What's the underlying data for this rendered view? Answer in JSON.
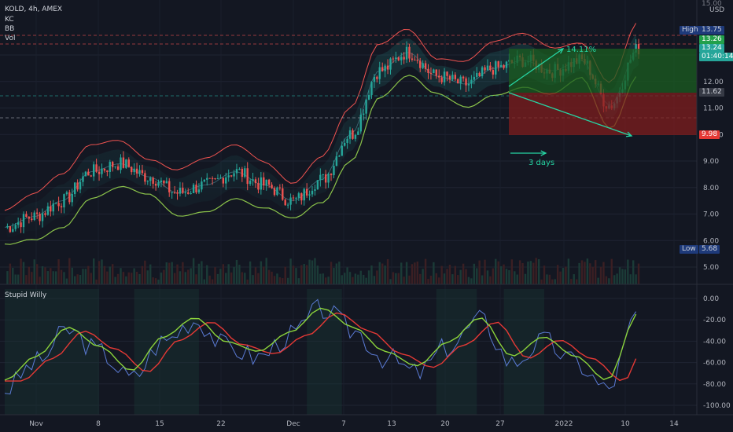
{
  "symbol": {
    "title": "KOLD, 4h, AMEX",
    "indicators": [
      "KC",
      "BB",
      "Vol"
    ]
  },
  "oscillator": {
    "title": "Stupid Willy"
  },
  "price_axis": {
    "currency": "USD",
    "top_label": "15.00",
    "ticks": [
      "13.00",
      "12.00",
      "11.00",
      "10.00",
      "9.00",
      "8.00",
      "7.00",
      "6.00",
      "5.00"
    ]
  },
  "osc_axis": {
    "ticks": [
      "0.00",
      "-20.00",
      "-40.00",
      "-60.00",
      "-80.00",
      "-100.00"
    ]
  },
  "time_axis": {
    "ticks": [
      "Nov",
      "8",
      "15",
      "22",
      "Dec",
      "7",
      "13",
      "20",
      "27",
      "2022",
      "10",
      "14"
    ]
  },
  "tags": {
    "high_label": "High",
    "high_value": "13.75",
    "price_a": "13.26",
    "last_price": "13.24",
    "countdown": "01:40:14",
    "entry": "11.62",
    "stop": "9.98",
    "low_label": "Low",
    "low_value": "5.68"
  },
  "annotations": {
    "gain_pct": "14.11%",
    "duration": "3 days"
  },
  "colors": {
    "background": "#131722",
    "up": "#26a69a",
    "down": "#ef5350",
    "bb_lower": "#8bc34a",
    "kc_upper": "#ef5350",
    "signal_green": "#8bd33b",
    "signal_red": "#e53935",
    "osc_line": "#5b7bd5",
    "arrow": "#26d6a4"
  },
  "chart_data": {
    "type": "line",
    "x": [
      "Nov",
      "8",
      "15",
      "22",
      "Dec",
      "7",
      "13",
      "20",
      "27",
      "2022",
      "10",
      "14"
    ],
    "series": [
      {
        "values": [
          6.5,
          6.9,
          7.5,
          8.6,
          8.9,
          8.4,
          7.8,
          8.1,
          8.6,
          8.1,
          7.5,
          8.3,
          10.0,
          12.4,
          13.1,
          12.2,
          11.9,
          12.5,
          12.8,
          12.4,
          12.8,
          11.1,
          13.24
        ]
      },
      {
        "values": [
          -85,
          -60,
          -30,
          -50,
          -75,
          -40,
          -20,
          -45,
          -55,
          -35,
          -10,
          -30,
          -55,
          -70,
          -45,
          -20,
          -60,
          -40,
          -60,
          -85,
          -15
        ]
      }
    ],
    "ylim_price": [
      5,
      15
    ],
    "ylim_osc": [
      -100,
      0
    ]
  }
}
